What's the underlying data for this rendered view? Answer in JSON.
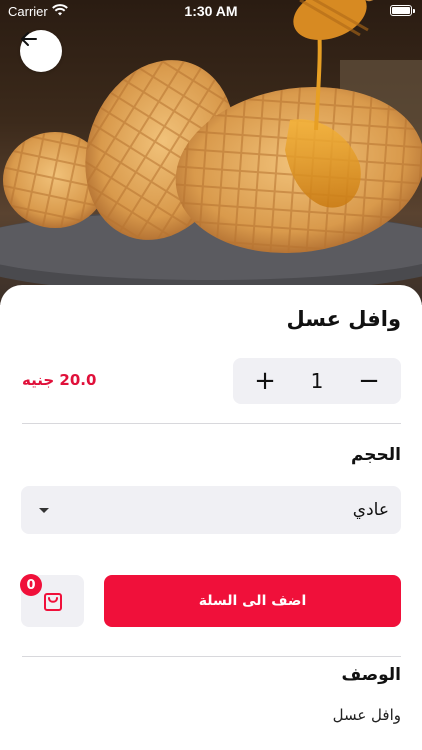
{
  "status_bar": {
    "carrier": "Carrier",
    "time": "1:30 AM"
  },
  "product": {
    "title": "وافل عسل",
    "price": "20.0 جنيه",
    "quantity": "1"
  },
  "size_section": {
    "label": "الحجم",
    "selected": "عادي"
  },
  "actions": {
    "add_to_cart_label": "اضف الى السلة",
    "cart_count": "0"
  },
  "description": {
    "label": "الوصف",
    "text": "وافل عسل"
  },
  "colors": {
    "accent": "#f0103a",
    "price": "#e0103a",
    "field_bg": "#f0f0f4"
  }
}
